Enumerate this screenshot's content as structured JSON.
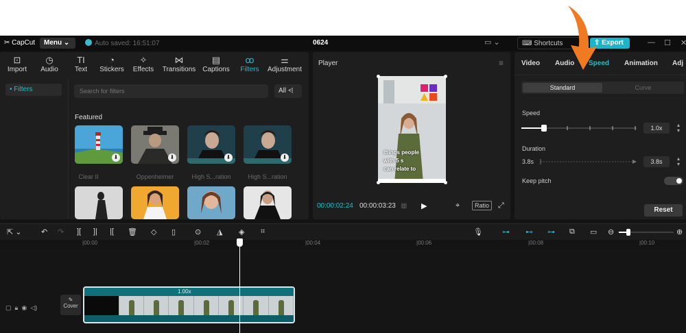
{
  "window": {
    "app_name": "CapCut",
    "menu_label": "Menu",
    "save_status": "Auto saved: 16:51:07",
    "project_title": "0624",
    "shortcuts_label": "Shortcuts",
    "export_label": "Export"
  },
  "media_tabs": [
    {
      "label": "Import",
      "icon": "import-icon"
    },
    {
      "label": "Audio",
      "icon": "audio-icon"
    },
    {
      "label": "Text",
      "icon": "text-icon"
    },
    {
      "label": "Stickers",
      "icon": "stickers-icon"
    },
    {
      "label": "Effects",
      "icon": "effects-icon"
    },
    {
      "label": "Transitions",
      "icon": "transitions-icon"
    },
    {
      "label": "Captions",
      "icon": "captions-icon"
    },
    {
      "label": "Filters",
      "icon": "filters-icon",
      "active": true
    },
    {
      "label": "Adjustment",
      "icon": "adjustment-icon"
    }
  ],
  "filters": {
    "sidebar_item": "• Filters",
    "search_placeholder": "Search for filters",
    "all_button": "All",
    "section_title": "Featured",
    "items": [
      {
        "label": "Clear II"
      },
      {
        "label": "Oppenheimer"
      },
      {
        "label": "High S...ration"
      },
      {
        "label": "High S...ration"
      }
    ]
  },
  "player": {
    "title": "Player",
    "current_time": "00:00:02:24",
    "total_time": "00:00:03:23",
    "ratio_label": "Ratio",
    "caption_lines": [
      "things people",
      "with 5 s",
      "can relate to"
    ]
  },
  "inspector": {
    "tabs": [
      "Video",
      "Audio",
      "Speed",
      "Animation",
      "Adj"
    ],
    "active_tab": "Speed",
    "modes": [
      "Standard",
      "Curve"
    ],
    "speed_label": "Speed",
    "speed_value": "1.0x",
    "speed_level": 0.2,
    "duration_label": "Duration",
    "duration_start": "3.8s",
    "duration_value": "3.8s",
    "keep_pitch_label": "Keep pitch",
    "keep_pitch_on": true,
    "reset_label": "Reset"
  },
  "timeline": {
    "ruler_labels": [
      "|00:00",
      "|00:02",
      "|00:04",
      "|00:06",
      "|00:08",
      "|00:10"
    ],
    "clip_speed_label": "1.00x",
    "cover_label": "Cover"
  },
  "colors": {
    "accent": "#18b6c8",
    "export_button": "#18b6c8",
    "arrow": "#f07a22"
  }
}
